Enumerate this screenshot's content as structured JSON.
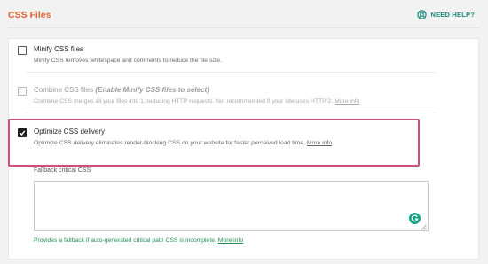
{
  "header": {
    "title": "CSS Files",
    "help_label": "NEED HELP?",
    "help_icon": "lifebuoy-icon"
  },
  "options": [
    {
      "title": "Minify CSS files",
      "description": "Minify CSS removes whitespace and comments to reduce the file size.",
      "checked": false,
      "disabled": false
    },
    {
      "title": "Combine CSS files",
      "title_note": "(Enable Minify CSS files to select)",
      "description": "Combine CSS merges all your files into 1, reducing HTTP requests. Not recommended if your site uses HTTP/2.",
      "link": "More info",
      "checked": false,
      "disabled": true
    },
    {
      "title": "Optimize CSS delivery",
      "description": "Optimize CSS delivery eliminates render-blocking CSS on your website for faster perceived load time.",
      "link": "More info",
      "checked": true,
      "disabled": false
    }
  ],
  "fallback": {
    "label": "Fallback critical CSS",
    "value": "",
    "help_text": "Provides a fallback if auto-generated critical path CSS is incomplete.",
    "link": "More info"
  },
  "colors": {
    "title": "#e0632f",
    "help": "#1c8a7e",
    "highlight_border": "#d54d78",
    "fallback_help": "#1f8f55",
    "grammarly": "#15a388"
  }
}
